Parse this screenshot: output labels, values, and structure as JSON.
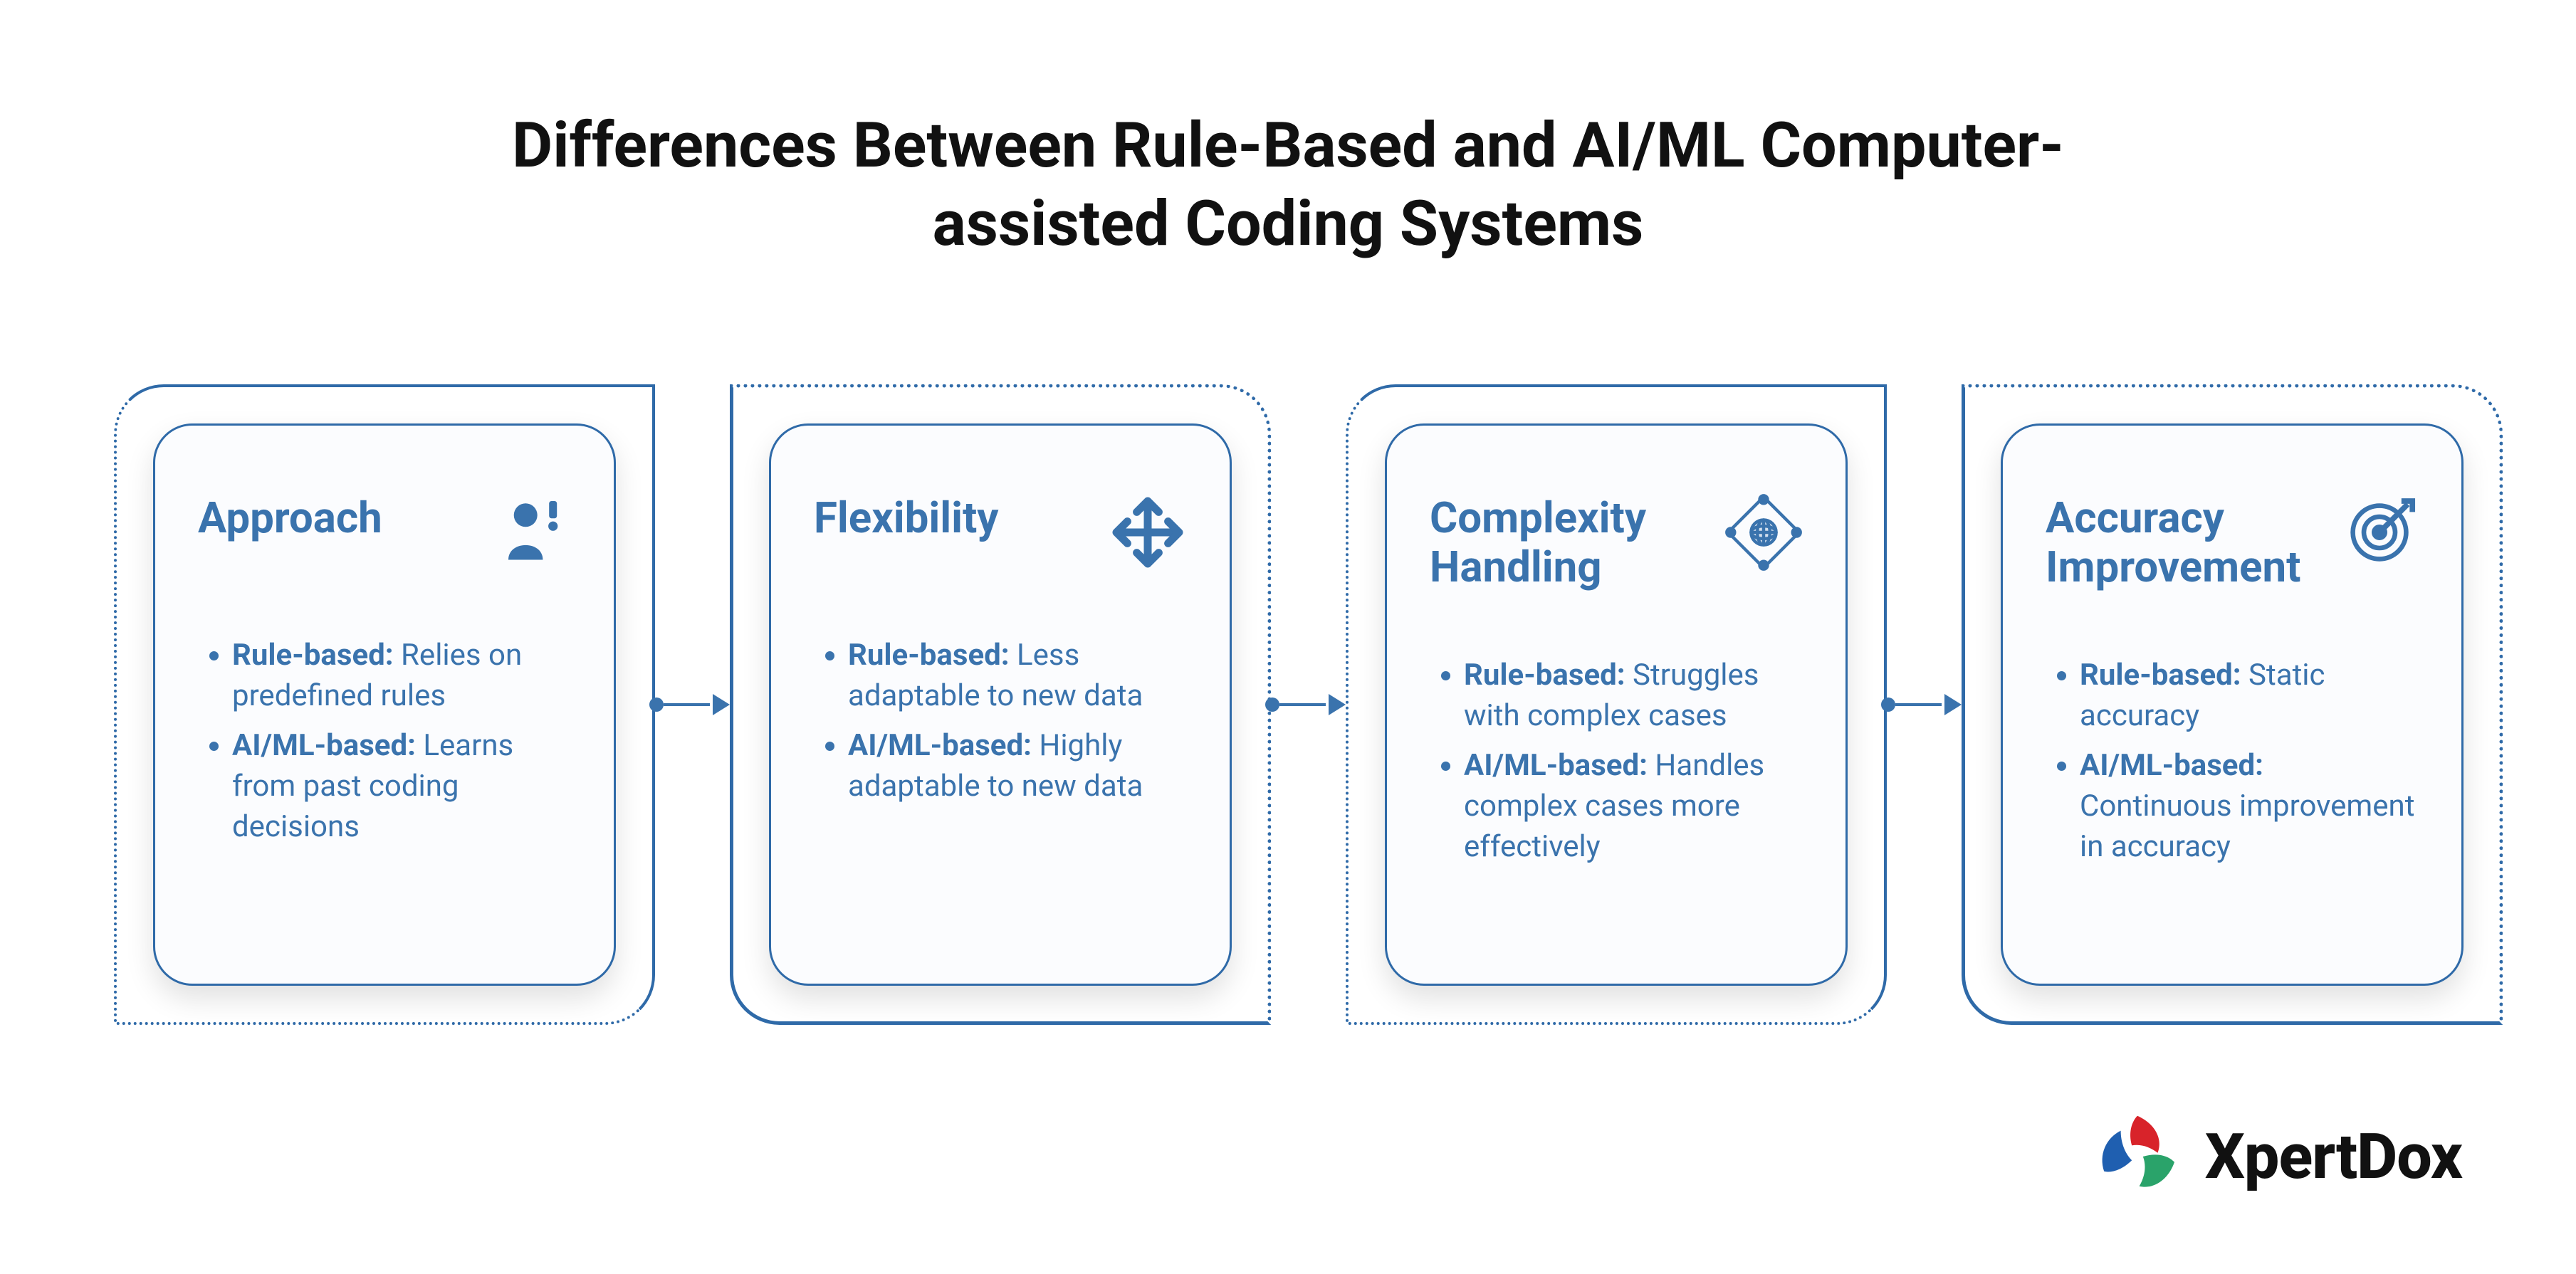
{
  "title": "Differences Between Rule-Based and AI/ML Computer-assisted Coding Systems",
  "cards": [
    {
      "title": "Approach",
      "icon": "person-icon",
      "rule_label": "Rule-based:",
      "rule_text": " Relies on predefined rules",
      "ai_label": "AI/ML-based:",
      "ai_text": " Learns from past coding decisions"
    },
    {
      "title": "Flexibility",
      "icon": "move-icon",
      "rule_label": "Rule-based:",
      "rule_text": " Less adaptable to new data",
      "ai_label": "AI/ML-based:",
      "ai_text": " Highly adaptable to new data"
    },
    {
      "title": "Complexity Handling",
      "icon": "globe-network-icon",
      "rule_label": "Rule-based:",
      "rule_text": " Struggles with complex cases",
      "ai_label": "AI/ML-based:",
      "ai_text": " Handles complex cases more effectively"
    },
    {
      "title": "Accuracy Improvement",
      "icon": "target-icon",
      "rule_label": "Rule-based:",
      "rule_text": " Static accuracy",
      "ai_label": "AI/ML-based:",
      "ai_text": " Continuous improvement in accuracy"
    }
  ],
  "brand": "XpertDox",
  "colors": {
    "primary": "#3a73ad",
    "border": "#2f6aa8",
    "text": "#111"
  }
}
